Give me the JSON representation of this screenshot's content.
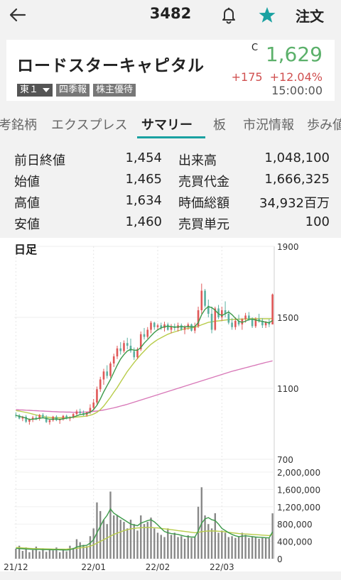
{
  "header": {
    "code": "3482",
    "order_label": "注文"
  },
  "stock": {
    "name": "ロードスターキャピタル",
    "market_flag": "C",
    "price": "1,629",
    "change": "+175",
    "change_pct": "+12.04%",
    "time": "15:00:00",
    "badges": [
      "東１",
      "四季報",
      "株主優待"
    ]
  },
  "tabs": [
    {
      "label": "考銘柄"
    },
    {
      "label": "エクスプレス"
    },
    {
      "label": "サマリー",
      "active": true
    },
    {
      "label": "板"
    },
    {
      "label": "市況情報"
    },
    {
      "label": "歩み値"
    }
  ],
  "summary": [
    {
      "l1": "前日終値",
      "v1": "1,454",
      "l2": "出来高",
      "v2": "1,048,100"
    },
    {
      "l1": "始値",
      "v1": "1,465",
      "l2": "売買代金",
      "v2": "1,666,325"
    },
    {
      "l1": "高値",
      "v1": "1,634",
      "l2": "時価総額",
      "v2": "34,932百万"
    },
    {
      "l1": "安値",
      "v1": "1,460",
      "l2": "売買単元",
      "v2": "100"
    }
  ],
  "colors": {
    "up": "#e05858",
    "down": "#5bb0a0",
    "ma_short": "#3d9a4a",
    "ma_mid": "#b8cc4a",
    "ma_long": "#d878b8",
    "accent": "#1aa1a1"
  },
  "chart_data": {
    "type": "candlestick",
    "title": "日足",
    "price_ticks": [
      "1900",
      "1500",
      "1100",
      "700"
    ],
    "price_ylim": [
      700,
      1900
    ],
    "volume_ticks": [
      "2,000,000",
      "1,600,000",
      "1,200,000",
      "800,000",
      "400,000",
      "0"
    ],
    "volume_ylim": [
      0,
      2000000
    ],
    "x_ticks": [
      {
        "label": "21/12",
        "index": 0
      },
      {
        "label": "22/01",
        "index": 23
      },
      {
        "label": "22/02",
        "index": 42
      },
      {
        "label": "22/03",
        "index": 61
      }
    ],
    "candles": [
      [
        950,
        965,
        935,
        948
      ],
      [
        948,
        955,
        925,
        930
      ],
      [
        930,
        945,
        915,
        940
      ],
      [
        940,
        950,
        905,
        912
      ],
      [
        912,
        930,
        895,
        925
      ],
      [
        925,
        945,
        910,
        935
      ],
      [
        935,
        950,
        920,
        928
      ],
      [
        928,
        955,
        918,
        950
      ],
      [
        950,
        960,
        930,
        938
      ],
      [
        938,
        948,
        905,
        910
      ],
      [
        910,
        925,
        895,
        920
      ],
      [
        920,
        945,
        912,
        940
      ],
      [
        940,
        948,
        915,
        920
      ],
      [
        920,
        930,
        900,
        925
      ],
      [
        925,
        950,
        918,
        945
      ],
      [
        945,
        952,
        925,
        930
      ],
      [
        930,
        942,
        915,
        935
      ],
      [
        935,
        960,
        930,
        955
      ],
      [
        955,
        980,
        945,
        970
      ],
      [
        970,
        985,
        950,
        960
      ],
      [
        960,
        975,
        945,
        950
      ],
      [
        950,
        968,
        940,
        965
      ],
      [
        965,
        1010,
        955,
        990
      ],
      [
        990,
        1040,
        975,
        1020
      ],
      [
        1020,
        1110,
        1005,
        1095
      ],
      [
        1095,
        1165,
        1080,
        1150
      ],
      [
        1150,
        1210,
        1120,
        1195
      ],
      [
        1195,
        1230,
        1155,
        1170
      ],
      [
        1170,
        1250,
        1160,
        1240
      ],
      [
        1240,
        1295,
        1220,
        1280
      ],
      [
        1280,
        1340,
        1265,
        1325
      ],
      [
        1325,
        1360,
        1290,
        1310
      ],
      [
        1310,
        1370,
        1300,
        1355
      ],
      [
        1355,
        1385,
        1320,
        1340
      ],
      [
        1340,
        1380,
        1300,
        1310
      ],
      [
        1310,
        1330,
        1260,
        1275
      ],
      [
        1275,
        1330,
        1265,
        1320
      ],
      [
        1320,
        1420,
        1310,
        1405
      ],
      [
        1405,
        1440,
        1375,
        1390
      ],
      [
        1390,
        1445,
        1380,
        1430
      ],
      [
        1430,
        1480,
        1410,
        1470
      ],
      [
        1470,
        1475,
        1430,
        1445
      ],
      [
        1445,
        1465,
        1425,
        1455
      ],
      [
        1455,
        1470,
        1430,
        1440
      ],
      [
        1440,
        1475,
        1420,
        1460
      ],
      [
        1460,
        1470,
        1425,
        1430
      ],
      [
        1430,
        1462,
        1410,
        1450
      ],
      [
        1450,
        1465,
        1425,
        1440
      ],
      [
        1440,
        1470,
        1420,
        1455
      ],
      [
        1455,
        1465,
        1425,
        1430
      ],
      [
        1430,
        1455,
        1405,
        1445
      ],
      [
        1445,
        1470,
        1430,
        1460
      ],
      [
        1460,
        1465,
        1420,
        1425
      ],
      [
        1425,
        1470,
        1410,
        1450
      ],
      [
        1450,
        1560,
        1440,
        1540
      ],
      [
        1540,
        1690,
        1520,
        1650
      ],
      [
        1650,
        1660,
        1555,
        1565
      ],
      [
        1565,
        1600,
        1500,
        1520
      ],
      [
        1520,
        1560,
        1410,
        1430
      ],
      [
        1430,
        1560,
        1425,
        1550
      ],
      [
        1550,
        1570,
        1490,
        1500
      ],
      [
        1500,
        1560,
        1480,
        1540
      ],
      [
        1540,
        1590,
        1500,
        1520
      ],
      [
        1520,
        1540,
        1460,
        1470
      ],
      [
        1470,
        1495,
        1430,
        1445
      ],
      [
        1445,
        1500,
        1430,
        1480
      ],
      [
        1480,
        1515,
        1450,
        1460
      ],
      [
        1460,
        1495,
        1430,
        1490
      ],
      [
        1490,
        1525,
        1470,
        1510
      ],
      [
        1510,
        1530,
        1480,
        1490
      ],
      [
        1490,
        1500,
        1440,
        1450
      ],
      [
        1450,
        1500,
        1440,
        1490
      ],
      [
        1490,
        1520,
        1470,
        1480
      ],
      [
        1480,
        1495,
        1440,
        1455
      ],
      [
        1455,
        1480,
        1440,
        1470
      ],
      [
        1470,
        1490,
        1445,
        1460
      ],
      [
        1460,
        1634,
        1460,
        1629
      ]
    ],
    "ma_short": [
      948,
      942,
      938,
      932,
      925,
      926,
      928,
      932,
      934,
      930,
      926,
      926,
      928,
      925,
      928,
      932,
      935,
      938,
      945,
      952,
      955,
      958,
      965,
      980,
      1005,
      1040,
      1080,
      1115,
      1150,
      1190,
      1230,
      1265,
      1290,
      1310,
      1320,
      1315,
      1315,
      1330,
      1355,
      1375,
      1395,
      1415,
      1430,
      1440,
      1448,
      1450,
      1448,
      1445,
      1446,
      1448,
      1446,
      1448,
      1446,
      1448,
      1470,
      1515,
      1545,
      1560,
      1555,
      1540,
      1520,
      1510,
      1520,
      1530,
      1515,
      1495,
      1478,
      1472,
      1478,
      1488,
      1490,
      1485,
      1480,
      1478,
      1472,
      1470,
      1482
    ],
    "ma_mid": [
      975,
      972,
      968,
      964,
      960,
      955,
      950,
      946,
      942,
      938,
      936,
      935,
      935,
      934,
      934,
      935,
      936,
      937,
      938,
      940,
      942,
      944,
      948,
      955,
      965,
      980,
      1000,
      1025,
      1050,
      1078,
      1105,
      1135,
      1165,
      1195,
      1220,
      1245,
      1268,
      1290,
      1310,
      1330,
      1348,
      1362,
      1375,
      1385,
      1395,
      1405,
      1412,
      1418,
      1424,
      1430,
      1434,
      1438,
      1440,
      1444,
      1450,
      1458,
      1465,
      1472,
      1475,
      1478,
      1480,
      1482,
      1485,
      1487,
      1488,
      1489,
      1490,
      1490,
      1491,
      1492,
      1492,
      1492,
      1492,
      1492,
      1492,
      1492,
      1494
    ],
    "ma_long": [
      980,
      979,
      978,
      977,
      976,
      975,
      974,
      973,
      972,
      971,
      970,
      969,
      968,
      967,
      967,
      966,
      966,
      965,
      965,
      965,
      966,
      967,
      968,
      970,
      972,
      975,
      978,
      982,
      986,
      990,
      995,
      1000,
      1005,
      1010,
      1016,
      1022,
      1028,
      1034,
      1040,
      1046,
      1052,
      1058,
      1064,
      1070,
      1076,
      1082,
      1088,
      1094,
      1100,
      1106,
      1112,
      1118,
      1124,
      1130,
      1136,
      1142,
      1148,
      1154,
      1160,
      1166,
      1172,
      1178,
      1184,
      1190,
      1196,
      1201,
      1206,
      1211,
      1216,
      1221,
      1226,
      1231,
      1236,
      1241,
      1246,
      1250,
      1255
    ],
    "volume": [
      230000,
      300000,
      180000,
      260000,
      150000,
      200000,
      280000,
      170000,
      240000,
      160000,
      210000,
      190000,
      260000,
      150000,
      220000,
      170000,
      300000,
      250000,
      450000,
      380000,
      320000,
      290000,
      520000,
      700000,
      1300000,
      1100000,
      900000,
      800000,
      1550000,
      1000000,
      1000000,
      900000,
      850000,
      700000,
      900000,
      800000,
      650000,
      1000000,
      800000,
      850000,
      950000,
      700000,
      600000,
      550000,
      500000,
      700000,
      550000,
      600000,
      500000,
      520000,
      460000,
      540000,
      480000,
      500000,
      1200000,
      1650000,
      1000000,
      800000,
      700000,
      1050000,
      600000,
      650000,
      600000,
      500000,
      520000,
      480000,
      500000,
      600000,
      550000,
      480000,
      520000,
      500000,
      460000,
      500000,
      480000,
      470000,
      1048100
    ],
    "vol_ma_short": [
      240000,
      235000,
      230000,
      225000,
      220000,
      215000,
      215000,
      215000,
      210000,
      210000,
      210000,
      205000,
      210000,
      205000,
      205000,
      200000,
      210000,
      230000,
      270000,
      290000,
      300000,
      310000,
      360000,
      440000,
      600000,
      750000,
      900000,
      1000000,
      1150000,
      1050000,
      1000000,
      950000,
      900000,
      850000,
      800000,
      780000,
      760000,
      820000,
      850000,
      880000,
      900000,
      850000,
      780000,
      700000,
      630000,
      600000,
      580000,
      570000,
      560000,
      540000,
      520000,
      510000,
      500000,
      500000,
      640000,
      820000,
      920000,
      950000,
      900000,
      880000,
      800000,
      700000,
      650000,
      600000,
      560000,
      530000,
      510000,
      520000,
      530000,
      520000,
      510000,
      500000,
      495000,
      490000,
      485000,
      480000,
      620000
    ],
    "vol_ma_mid": [
      260000,
      255000,
      250000,
      245000,
      240000,
      235000,
      232000,
      230000,
      228000,
      226000,
      224000,
      222000,
      220000,
      220000,
      220000,
      222000,
      226000,
      232000,
      240000,
      250000,
      260000,
      270000,
      290000,
      320000,
      360000,
      400000,
      440000,
      480000,
      520000,
      560000,
      590000,
      620000,
      650000,
      670000,
      690000,
      700000,
      710000,
      715000,
      720000,
      720000,
      720000,
      715000,
      710000,
      700000,
      690000,
      680000,
      670000,
      660000,
      650000,
      640000,
      630000,
      620000,
      610000,
      600000,
      610000,
      625000,
      635000,
      640000,
      640000,
      640000,
      635000,
      630000,
      620000,
      610000,
      600000,
      590000,
      580000,
      575000,
      570000,
      565000,
      560000,
      555000,
      550000,
      545000,
      540000,
      535000,
      560000
    ]
  }
}
